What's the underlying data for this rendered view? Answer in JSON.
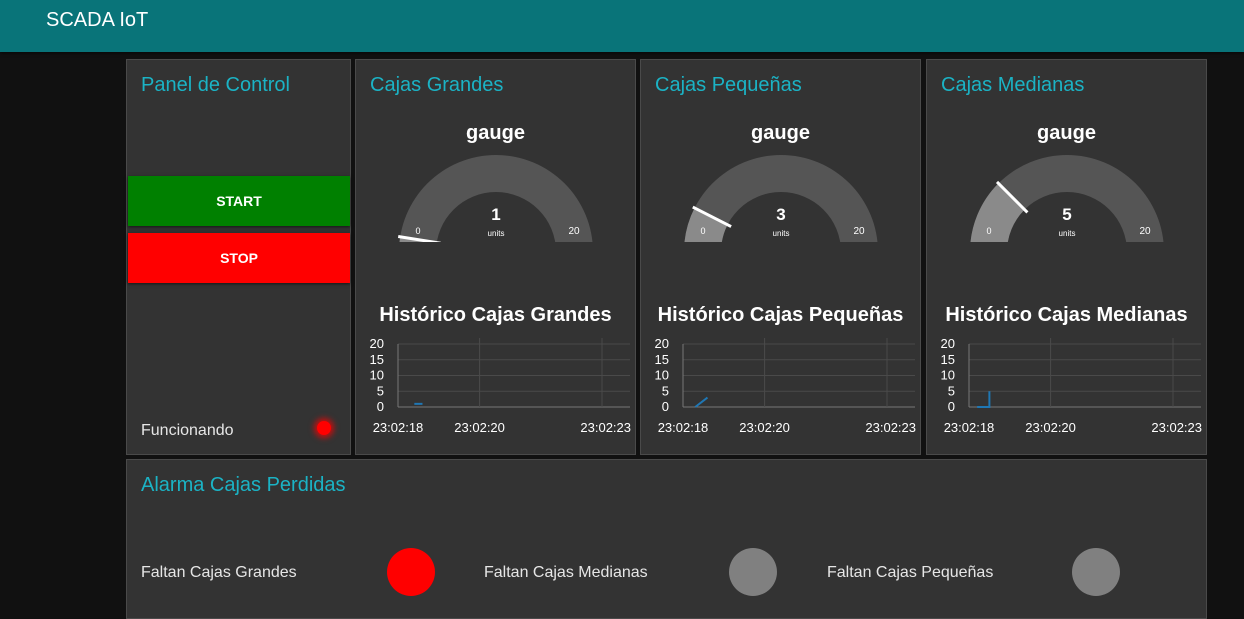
{
  "app": {
    "title": "SCADA IoT"
  },
  "control_panel": {
    "title": "Panel de Control",
    "start_label": "START",
    "stop_label": "STOP",
    "status_label": "Funcionando",
    "colors": {
      "start": "#008000",
      "stop": "#ff0000",
      "led": "#ff0000"
    }
  },
  "gauges": [
    {
      "title": "Cajas Grandes",
      "gauge_label": "gauge",
      "value": "1",
      "units": "units",
      "min": "0",
      "max": "20"
    },
    {
      "title": "Cajas Pequeñas",
      "gauge_label": "gauge",
      "value": "3",
      "units": "units",
      "min": "0",
      "max": "20"
    },
    {
      "title": "Cajas Medianas",
      "gauge_label": "gauge",
      "value": "5",
      "units": "units",
      "min": "0",
      "max": "20"
    }
  ],
  "histories": [
    {
      "title": "Histórico Cajas Grandes",
      "yticks": [
        "20",
        "15",
        "10",
        "5",
        "0"
      ],
      "xticks": [
        "23:02:18",
        "23:02:20",
        "23:02:23"
      ]
    },
    {
      "title": "Histórico Cajas Pequeñas",
      "yticks": [
        "20",
        "15",
        "10",
        "5",
        "0"
      ],
      "xticks": [
        "23:02:18",
        "23:02:20",
        "23:02:23"
      ]
    },
    {
      "title": "Histórico Cajas Medianas",
      "yticks": [
        "20",
        "15",
        "10",
        "5",
        "0"
      ],
      "xticks": [
        "23:02:18",
        "23:02:20",
        "23:02:23"
      ]
    }
  ],
  "chart_data": [
    {
      "type": "line",
      "title": "Histórico Cajas Grandes",
      "x": [
        "23:02:18.4",
        "23:02:18.6"
      ],
      "y": [
        1,
        1
      ],
      "ylim": [
        0,
        20
      ],
      "xticks": [
        "23:02:18",
        "23:02:20",
        "23:02:23"
      ],
      "color": "#1f77b4"
    },
    {
      "type": "line",
      "title": "Histórico Cajas Pequeñas",
      "x": [
        "23:02:18.3",
        "23:02:18.6"
      ],
      "y": [
        0,
        3
      ],
      "ylim": [
        0,
        20
      ],
      "xticks": [
        "23:02:18",
        "23:02:20",
        "23:02:23"
      ],
      "color": "#1f77b4"
    },
    {
      "type": "line",
      "title": "Histórico Cajas Medianas",
      "x": [
        "23:02:18.2",
        "23:02:18.5",
        "23:02:18.5"
      ],
      "y": [
        0,
        0,
        5
      ],
      "ylim": [
        0,
        20
      ],
      "xticks": [
        "23:02:18",
        "23:02:20",
        "23:02:23"
      ],
      "color": "#1f77b4"
    }
  ],
  "alarms": {
    "title": "Alarma Cajas Perdidas",
    "items": [
      {
        "label": "Faltan Cajas Grandes",
        "color": "#ff0000"
      },
      {
        "label": "Faltan Cajas Medianas",
        "color": "#808080"
      },
      {
        "label": "Faltan Cajas Pequeñas",
        "color": "#808080"
      }
    ]
  }
}
